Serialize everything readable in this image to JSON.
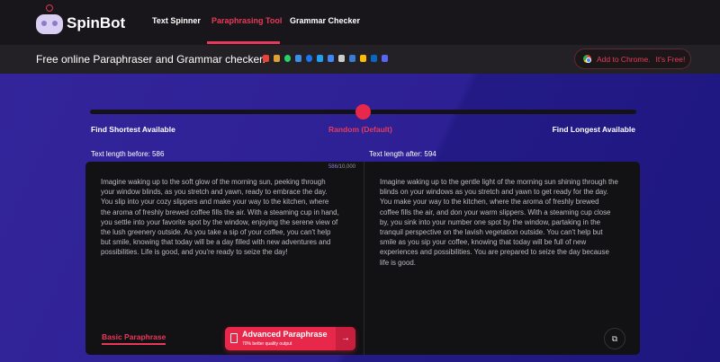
{
  "header": {
    "logo": "SpinBot",
    "nav": [
      {
        "label": "Text Spinner"
      },
      {
        "label": "Paraphrasing Tool",
        "active": true
      },
      {
        "label": "Grammar Checker"
      }
    ]
  },
  "subbar": {
    "tagline": "Free online Paraphraser and Grammar checker.",
    "share_icons": [
      "gmail-icon",
      "slack-icon",
      "whatsapp-icon",
      "share-icon",
      "facebook-icon",
      "twitter-icon",
      "google-docs-icon",
      "notion-icon",
      "x-icon",
      "google-keep-icon",
      "linkedin-icon",
      "discord-icon"
    ],
    "chrome_cta": "Add to Chrome.",
    "chrome_free": "It's Free!"
  },
  "slider": {
    "left": "Find Shortest Available",
    "center": "Random (Default)",
    "right": "Find Longest Available",
    "value": 0.5
  },
  "lengths": {
    "before": "Text length before: 586",
    "after": "Text length after: 594"
  },
  "input": {
    "count": "586",
    "max": "/10,000",
    "text": "Imagine waking up to the soft glow of the morning sun, peeking through your window blinds, as you stretch and yawn, ready to embrace the day. You slip into your cozy slippers and make your way to the kitchen, where the aroma of freshly brewed coffee fills the air. With a steaming cup in hand, you settle into your favorite spot by the window, enjoying the serene view of the lush greenery outside. As you take a sip of your coffee, you can't help but smile, knowing that today will be a day filled with new adventures and possibilities. Life is good, and you're ready to seize the day!"
  },
  "output": {
    "text": "Imagine waking up to the gentle light of the morning sun shining through the blinds on your windows as you stretch and yawn to get ready for the day. You make your way to the kitchen, where the aroma of freshly brewed coffee fills the air, and don your warm slippers. With a steaming cup close by, you sink into your number one spot by the window, partaking in the tranquil perspective on the lavish vegetation outside. You can't help but smile as you sip your coffee, knowing that today will be full of new experiences and possibilities. You are prepared to seize the day because life is good."
  },
  "buttons": {
    "basic": "Basic Paraphrase",
    "advanced": "Advanced Paraphrase",
    "advanced_sub": "70% better quality output"
  },
  "colors": {
    "accent": "#e8284b",
    "bg": "#2b1f8c"
  }
}
